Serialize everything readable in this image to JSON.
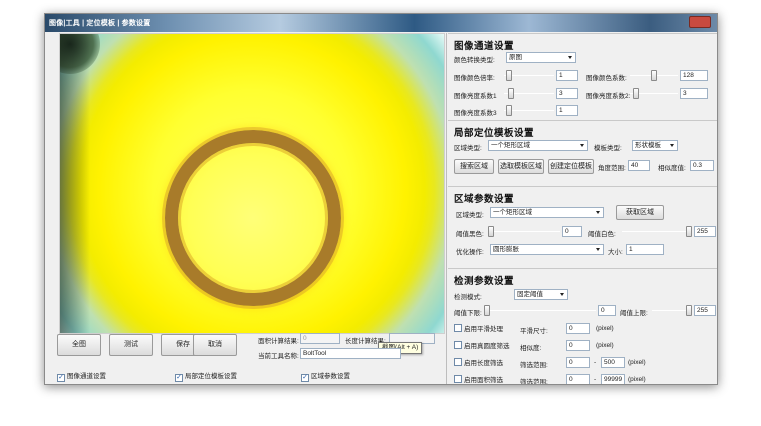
{
  "window": {
    "title": "图像|工具 | 定位模板 | 参数设置"
  },
  "viewport": {
    "name": "camera-view"
  },
  "bottom": {
    "buttons": [
      "全图",
      "测试",
      "保存",
      "取消"
    ],
    "area_result_label": "面积计算结果:",
    "area_result_value": "0",
    "length_result_label": "长度计算结果:",
    "length_result_value": "",
    "tool_name_label": "当前工具名称:",
    "tool_name_value": "BoltTool",
    "tooltip": "截图(Alt + A)",
    "checkboxes": [
      {
        "label": "图像通道设置",
        "checked": true
      },
      {
        "label": "局部定位模板设置",
        "checked": true
      },
      {
        "label": "区域参数设置",
        "checked": true
      }
    ]
  },
  "channel": {
    "title": "图像通道设置",
    "color_type_label": "颜色转换类型:",
    "color_type_value": "原图",
    "gain_label": "图像颜色倍率:",
    "gain_value": "1",
    "gain_level": 0.05,
    "color_coef_label": "图像颜色系数:",
    "color_coef_value": "128",
    "color_coef_level": 0.5,
    "contrast1_label": "图像亮度系数1",
    "contrast1_value": "3",
    "contrast1_level": 0.08,
    "contrast2_label": "图像亮度系数2:",
    "contrast2_value": "3",
    "contrast2_level": 0.08,
    "contrast3_label": "图像亮度系数3",
    "contrast3_value": "1",
    "contrast3_level": 0.05
  },
  "locate": {
    "title": "局部定位模板设置",
    "region_type_label": "区域类型:",
    "region_type_value": "一个矩形区域",
    "template_type_label": "模板类型:",
    "template_type_value": "形状模板",
    "search_button": "搜索区域",
    "select_template_button": "选取模板区域",
    "create_template_button": "创建定位模板",
    "angle_label": "角度范围:",
    "angle_value": "40",
    "similarity_label": "相似度值:",
    "similarity_value": "0.3"
  },
  "region": {
    "title": "区域参数设置",
    "region_type_label": "区域类型:",
    "region_type_value": "一个矩形区域",
    "get_region_button": "获取区域",
    "black_label": "阈值黑色:",
    "black_value": "0",
    "black_level": 0.0,
    "white_label": "阈值白色:",
    "white_value": "255",
    "white_level": 1.0,
    "optimize_label": "优化操作:",
    "optimize_value": "圆形膨胀",
    "size_label": "大小:",
    "size_value": "1"
  },
  "detect": {
    "title": "检测参数设置",
    "mode_label": "检测模式:",
    "mode_value": "固定阈值",
    "lower_label": "阈值下限:",
    "lower_value": "0",
    "lower_level": 0.0,
    "upper_label": "阈值上限:",
    "upper_value": "255",
    "upper_level": 1.0,
    "rows": [
      {
        "check": "启用平滑处理",
        "label": "平滑尺寸:",
        "v1": "0",
        "unit": "(pixel)"
      },
      {
        "check": "启用真圆度筛选",
        "label": "相似度:",
        "v1": "0",
        "unit": "(pixel)"
      },
      {
        "check": "启用长度筛选",
        "label": "筛选范围:",
        "v1": "0",
        "sep": "-",
        "v2": "500",
        "unit": "(pixel)"
      },
      {
        "check": "启用面积筛选",
        "label": "筛选范围:",
        "v1": "0",
        "sep": "-",
        "v2": "99999",
        "unit": "(pixel)"
      }
    ]
  }
}
